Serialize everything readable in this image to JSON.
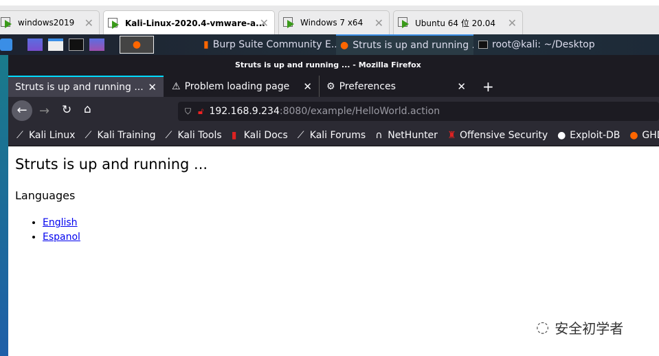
{
  "vm_tabs": [
    {
      "label": "windows2019"
    },
    {
      "label": "Kali-Linux-2020.4-vmware-a..."
    },
    {
      "label": "Windows 7 x64"
    },
    {
      "label": "Ubuntu 64 位 20.04"
    }
  ],
  "taskbar": {
    "windows": [
      {
        "label": "Burp Suite Community E..."
      },
      {
        "label": "Struts is up and running ...."
      },
      {
        "label": "root@kali: ~/Desktop"
      }
    ]
  },
  "window_title": "Struts is up and running ... - Mozilla Firefox",
  "browser_tabs": [
    {
      "label": "Struts is up and running ..."
    },
    {
      "label": "Problem loading page"
    },
    {
      "label": "Preferences"
    }
  ],
  "url": {
    "host": "192.168.9.234",
    "rest": ":8080/example/HelloWorld.action"
  },
  "bookmarks": [
    {
      "label": "Kali Linux"
    },
    {
      "label": "Kali Training"
    },
    {
      "label": "Kali Tools"
    },
    {
      "label": "Kali Docs"
    },
    {
      "label": "Kali Forums"
    },
    {
      "label": "NetHunter"
    },
    {
      "label": "Offensive Security"
    },
    {
      "label": "Exploit-DB"
    },
    {
      "label": "GHDB"
    }
  ],
  "page": {
    "heading": "Struts is up and running ...",
    "subheading": "Languages",
    "links": [
      {
        "label": "English"
      },
      {
        "label": "Espanol"
      }
    ]
  },
  "watermark": "安全初学者"
}
